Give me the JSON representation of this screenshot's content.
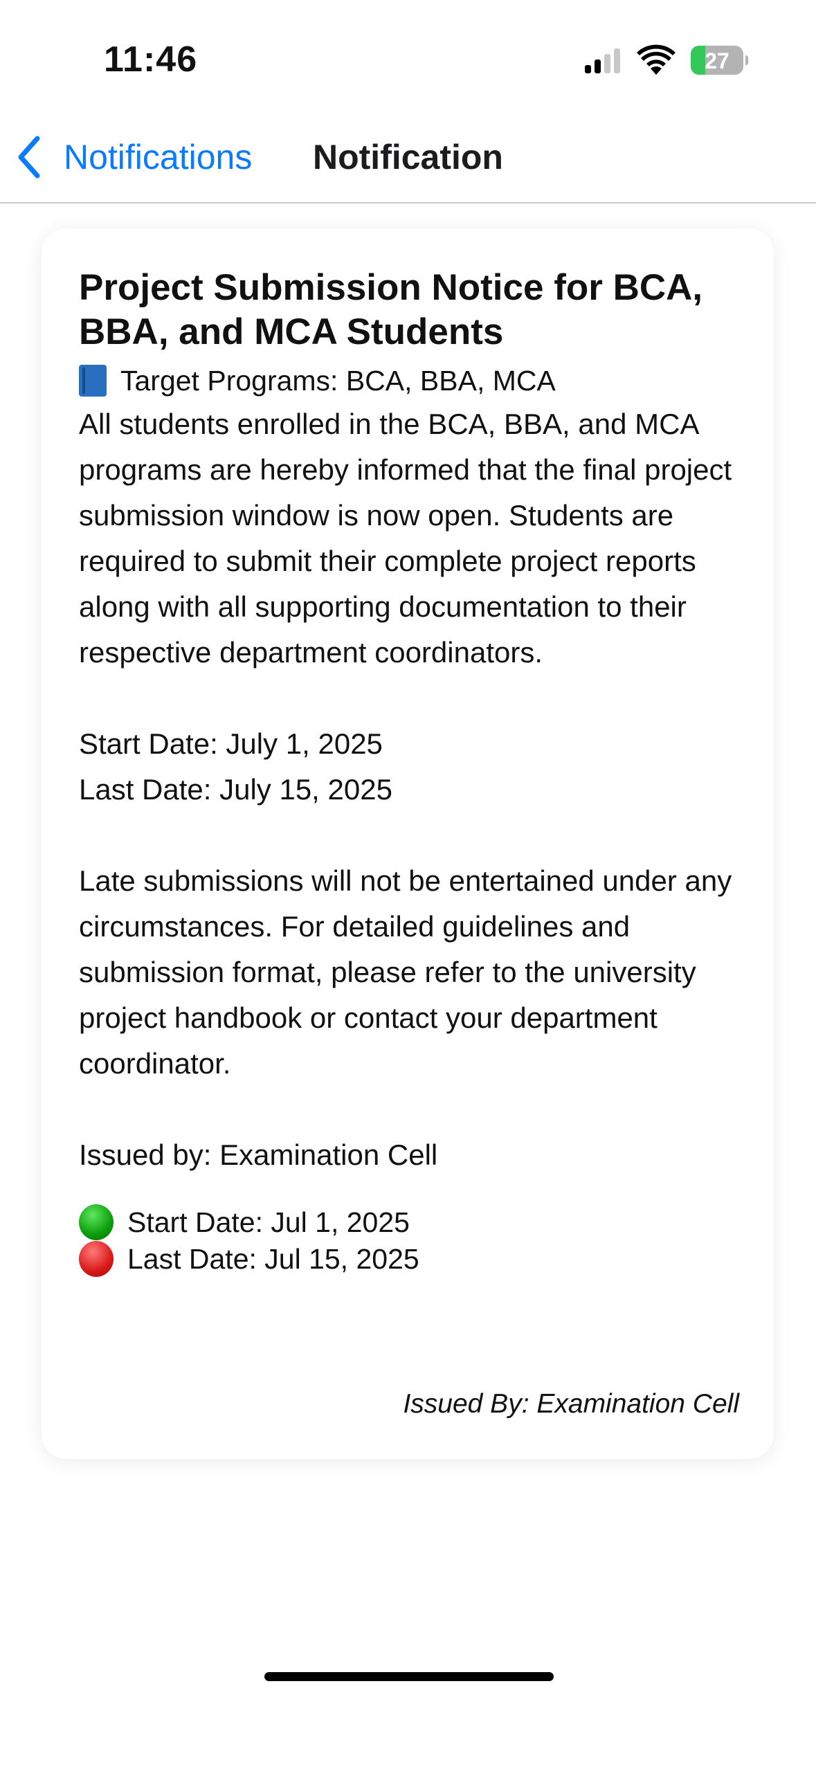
{
  "status_bar": {
    "time": "11:46",
    "battery": "27",
    "battery_level_percent": 27,
    "signal_bars_active": 2,
    "signal_bars_total": 4
  },
  "nav": {
    "back_label": "Notifications",
    "title": "Notification"
  },
  "notice": {
    "title": "Project Submission Notice for BCA, BBA, and MCA Students",
    "target_programs": "Target Programs: BCA, BBA, MCA",
    "body": "All students enrolled in the BCA, BBA, and MCA programs are hereby informed that the final project submission window is now open. Students are required to submit their complete project reports along with all supporting documentation to their respective department coordinators.\n\nStart Date: July 1, 2025\nLast Date: July 15, 2025\n\nLate submissions will not be entertained under any circumstances. For detailed guidelines and submission format, please refer to the university project handbook or contact your department coordinator.\n\nIssued by: Examination Cell",
    "start_date": "Start Date: Jul 1, 2025",
    "last_date": "Last Date: Jul 15, 2025",
    "issued_by": "Issued By: Examination Cell"
  },
  "colors": {
    "accent": "#0a7aff",
    "battery_green": "#34c759"
  }
}
